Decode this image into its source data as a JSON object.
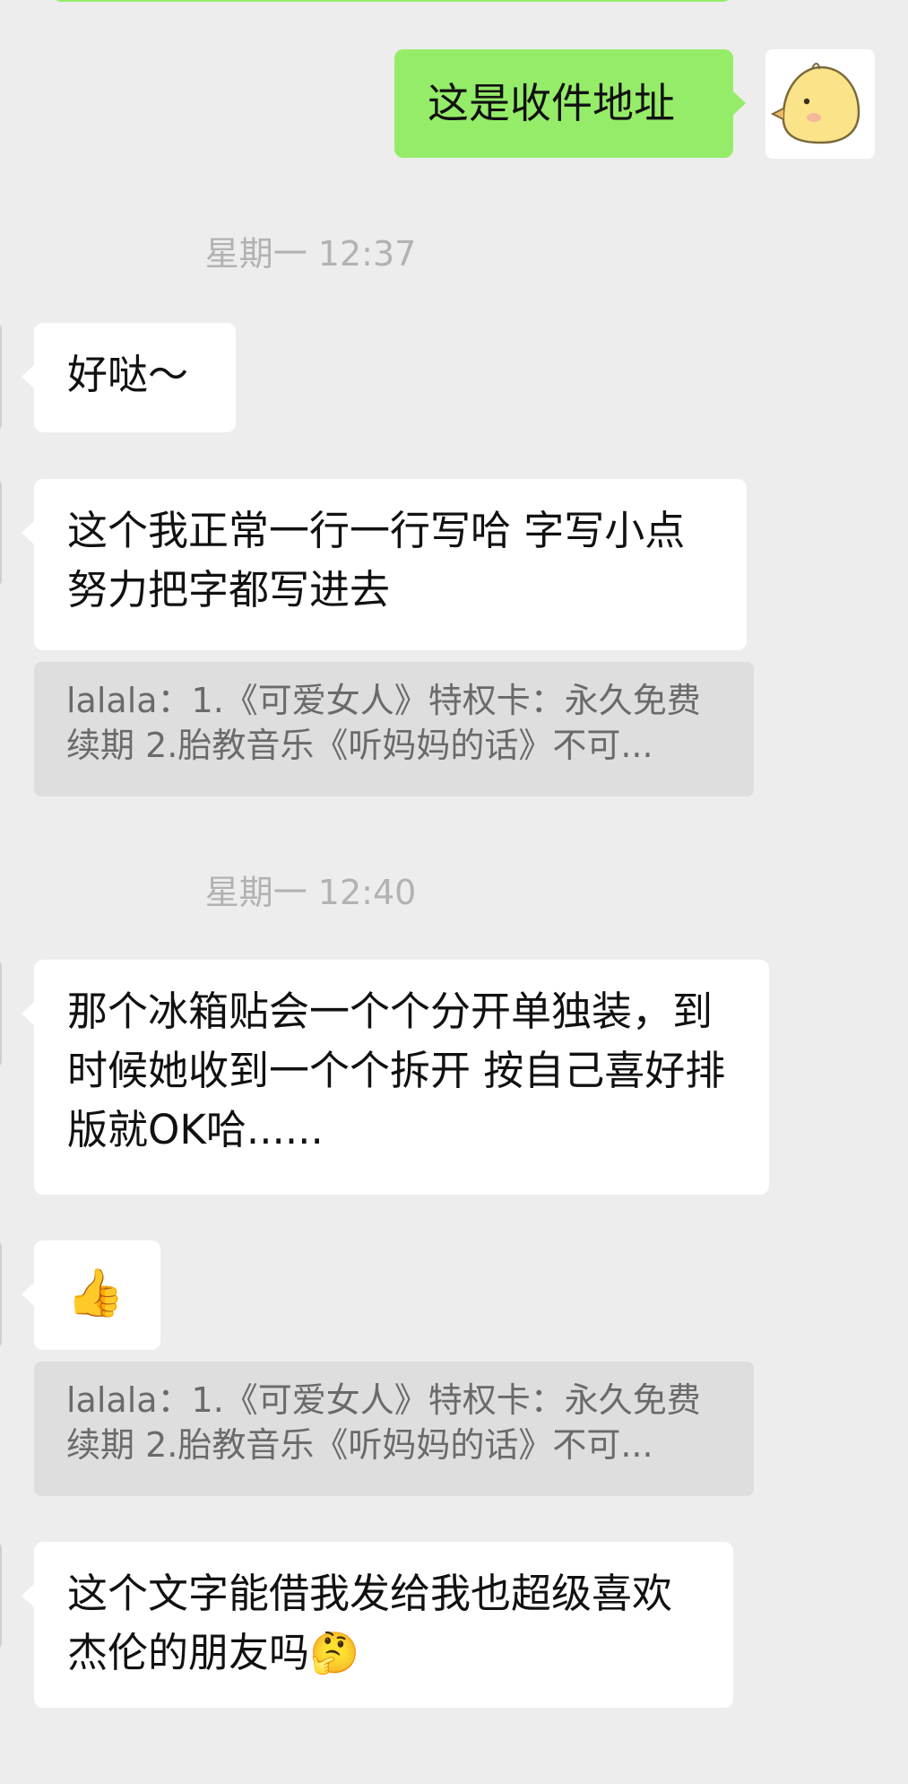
{
  "messages": [
    {
      "type": "outgoing",
      "text": "这是收件地址"
    },
    {
      "type": "timestamp",
      "text": "星期一 12:37"
    },
    {
      "type": "incoming",
      "text": "好哒～"
    },
    {
      "type": "incoming",
      "text": "这个我正常一行一行写哈 字写小点 努力把字都写进去"
    },
    {
      "type": "quote",
      "line1": "lalala：1.《可爱女人》特权卡：永久免费",
      "line2": "续期  2.胎教音乐《听妈妈的话》不可..."
    },
    {
      "type": "timestamp",
      "text": "星期一 12:40"
    },
    {
      "type": "incoming",
      "text": "那个冰箱贴会一个个分开单独装，到时候她收到一个个拆开 按自己喜好排版就OK哈......"
    },
    {
      "type": "incoming",
      "text": "👍"
    },
    {
      "type": "quote",
      "line1": "lalala：1.《可爱女人》特权卡：永久免费",
      "line2": "续期  2.胎教音乐《听妈妈的话》不可..."
    },
    {
      "type": "incoming",
      "text": "这个文字能借我发给我也超级喜欢杰伦的朋友吗🤔"
    }
  ],
  "my_avatar": {
    "icon": "chick-icon",
    "color": "#fbe38a"
  },
  "colors": {
    "background": "#ededed",
    "outgoing_bubble": "#95ec69",
    "incoming_bubble": "#ffffff",
    "quote_background": "#dedede",
    "timestamp_text": "#b2b2b2"
  }
}
